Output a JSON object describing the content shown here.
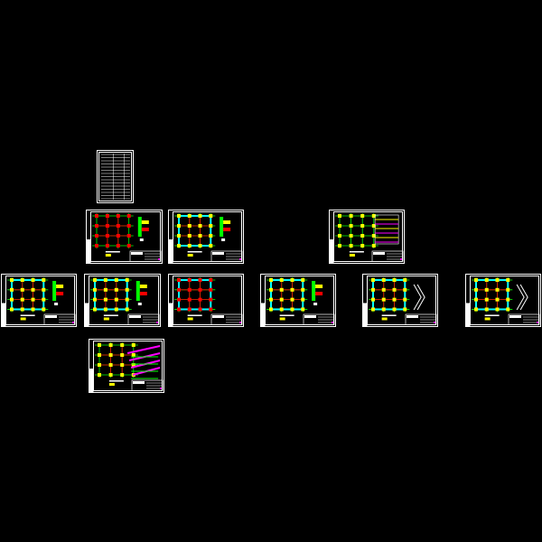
{
  "canvas": {
    "background": "#000000"
  },
  "colors": {
    "frame": "#ffffff",
    "grid": "#00ff00",
    "beam": "#ff0000",
    "wall": "#00ffff",
    "column": "#ffff00",
    "accent": "#ff00ff"
  },
  "sheets": [
    {
      "kind": "index-table"
    },
    {
      "kind": "foundation-plan"
    },
    {
      "kind": "column-plan"
    },
    {
      "kind": "plan-with-table"
    },
    {
      "kind": "floor-plan"
    },
    {
      "kind": "floor-plan"
    },
    {
      "kind": "beam-plan"
    },
    {
      "kind": "roof-plan"
    },
    {
      "kind": "roof-plan-section"
    },
    {
      "kind": "roof-plan-section"
    },
    {
      "kind": "section-details"
    }
  ]
}
